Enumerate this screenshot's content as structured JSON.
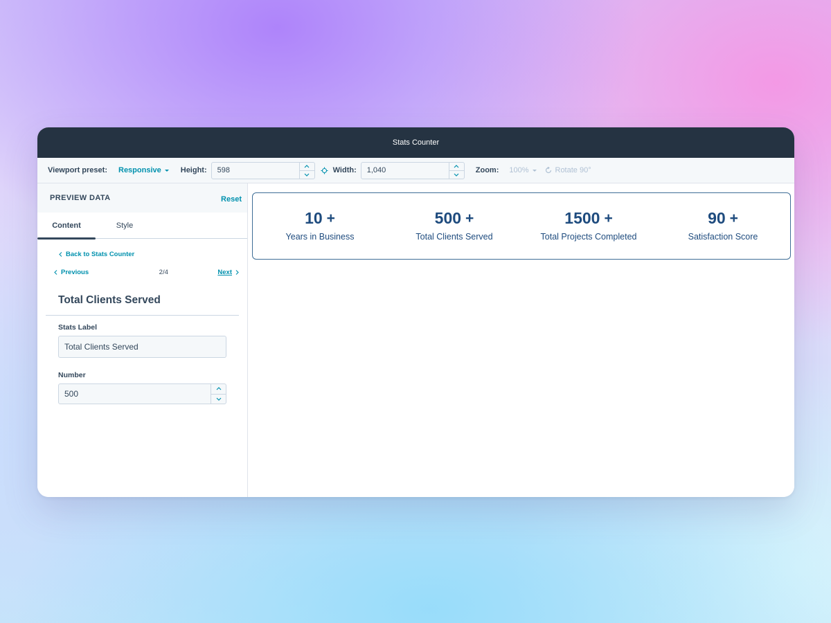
{
  "window": {
    "title": "Stats Counter"
  },
  "toolbar": {
    "viewport_label": "Viewport preset:",
    "viewport_value": "Responsive",
    "height_label": "Height:",
    "height_value": "598",
    "width_label": "Width:",
    "width_value": "1,040",
    "zoom_label": "Zoom:",
    "zoom_value": "100%",
    "rotate_label": "Rotate 90°"
  },
  "panel": {
    "title": "PREVIEW DATA",
    "reset": "Reset",
    "tabs": [
      {
        "label": "Content"
      },
      {
        "label": "Style"
      }
    ],
    "back_link": "Back to Stats Counter",
    "previous": "Previous",
    "next": "Next",
    "page_count": "2/4",
    "item_title": "Total Clients Served",
    "fields": {
      "stats_label": {
        "label": "Stats Label",
        "value": "Total Clients Served"
      },
      "number": {
        "label": "Number",
        "value": "500"
      }
    }
  },
  "stats": [
    {
      "number": "10",
      "suffix": "+",
      "label": "Years in Business"
    },
    {
      "number": "500",
      "suffix": "+",
      "label": "Total Clients Served"
    },
    {
      "number": "1500",
      "suffix": "+",
      "label": "Total Projects Completed"
    },
    {
      "number": "90",
      "suffix": "+",
      "label": "Satisfaction Score"
    }
  ],
  "colors": {
    "titlebar": "#253342",
    "accent": "#0091ae",
    "stat_text": "#1e4b7e",
    "border": "#cbd6e2"
  }
}
